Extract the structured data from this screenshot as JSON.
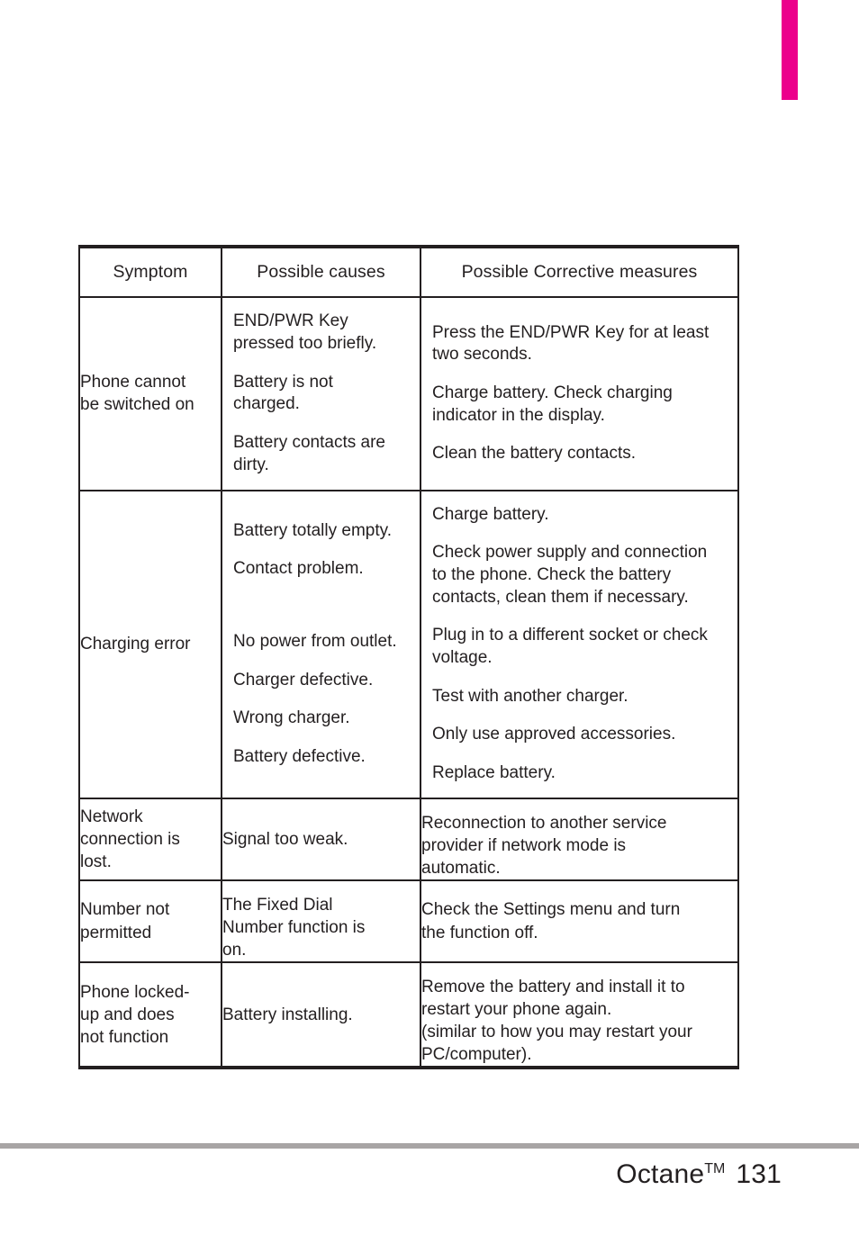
{
  "page": {
    "section_tab_color": "#ec008c",
    "rule_color": "#a8a5a5",
    "text_color": "#231f20"
  },
  "table": {
    "headers": {
      "symptom": "Symptom",
      "causes": "Possible causes",
      "measures": "Possible Corrective measures"
    },
    "rows": [
      {
        "symptom": "Phone cannot\nbe switched on",
        "causes": [
          "END/PWR Key\npressed too briefly.",
          "Battery is not\ncharged.",
          "Battery contacts are\ndirty."
        ],
        "measures": [
          "Press the END/PWR Key for at least\ntwo seconds.",
          "Charge battery. Check charging\nindicator in the display.",
          "Clean the battery contacts."
        ]
      },
      {
        "symptom": "Charging error",
        "causes": [
          "Battery totally empty.",
          "Contact problem.",
          "No power from outlet.",
          "Charger defective.",
          "Wrong charger.",
          "Battery defective."
        ],
        "measures": [
          "Charge battery.",
          "Check power supply and connection\nto the phone. Check the battery\ncontacts, clean them if necessary.",
          "Plug in to a different socket or check\nvoltage.",
          "Test with another charger.",
          "Only use approved accessories.",
          "Replace battery."
        ]
      },
      {
        "symptom": "Network\nconnection is\nlost.",
        "causes": [
          "Signal too weak."
        ],
        "measures": [
          "Reconnection to another service\nprovider if network mode is\nautomatic."
        ]
      },
      {
        "symptom": "Number not\npermitted",
        "causes": [
          "The Fixed Dial\nNumber function is\non."
        ],
        "measures": [
          "Check the Settings menu and turn\nthe function off."
        ]
      },
      {
        "symptom": "Phone locked-\nup and does\nnot function",
        "causes": [
          "Battery installing."
        ],
        "measures": [
          "Remove the battery and install it to\nrestart your phone again.\n(similar to how you may restart your\nPC/computer)."
        ]
      }
    ]
  },
  "footer": {
    "product": "Octane",
    "trademark": "TM",
    "page_number": "131"
  }
}
